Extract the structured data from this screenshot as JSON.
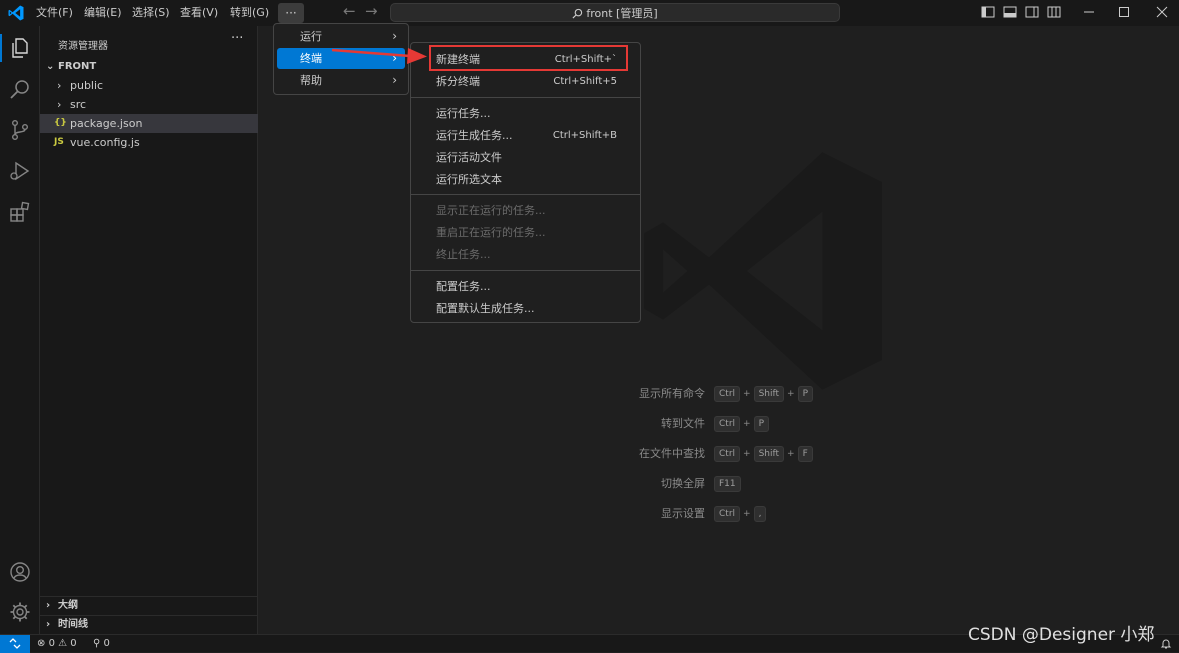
{
  "titlebar": {
    "menus": [
      "文件(F)",
      "编辑(E)",
      "选择(S)",
      "查看(V)",
      "转到(G)"
    ],
    "more": "···",
    "command_center": "front [管理员]"
  },
  "sidebar": {
    "title": "资源管理器",
    "more": "···",
    "folder": "FRONT",
    "items": [
      {
        "label": "public",
        "type": "folder"
      },
      {
        "label": "src",
        "type": "folder"
      },
      {
        "label": "package.json",
        "type": "file",
        "icon": "{}"
      },
      {
        "label": "vue.config.js",
        "type": "file",
        "icon": "JS"
      }
    ],
    "outline": "大纲",
    "timeline": "时间线"
  },
  "menu_top": {
    "items": [
      {
        "label": "运行"
      },
      {
        "label": "终端"
      },
      {
        "label": "帮助"
      }
    ]
  },
  "menu_terminal": {
    "items": [
      {
        "label": "新建终端",
        "shortcut": "Ctrl+Shift+`"
      },
      {
        "label": "拆分终端",
        "shortcut": "Ctrl+Shift+5"
      },
      {
        "label": "运行任务...",
        "shortcut": ""
      },
      {
        "label": "运行生成任务...",
        "shortcut": "Ctrl+Shift+B"
      },
      {
        "label": "运行活动文件",
        "shortcut": ""
      },
      {
        "label": "运行所选文本",
        "shortcut": ""
      },
      {
        "label": "显示正在运行的任务...",
        "shortcut": ""
      },
      {
        "label": "重启正在运行的任务...",
        "shortcut": ""
      },
      {
        "label": "终止任务...",
        "shortcut": ""
      },
      {
        "label": "配置任务...",
        "shortcut": ""
      },
      {
        "label": "配置默认生成任务...",
        "shortcut": ""
      }
    ]
  },
  "hints": [
    {
      "label": "显示所有命令",
      "keys": [
        "Ctrl",
        "Shift",
        "P"
      ]
    },
    {
      "label": "转到文件",
      "keys": [
        "Ctrl",
        "P"
      ]
    },
    {
      "label": "在文件中查找",
      "keys": [
        "Ctrl",
        "Shift",
        "F"
      ]
    },
    {
      "label": "切换全屏",
      "keys": [
        "F11"
      ]
    },
    {
      "label": "显示设置",
      "keys": [
        "Ctrl",
        ","
      ]
    }
  ],
  "statusbar": {
    "errors": "0",
    "warnings": "0",
    "ports": "0"
  },
  "watermark": "CSDN @Designer 小郑",
  "colors": {
    "accent": "#0078d4",
    "highlight": "#e53935",
    "background": "#1f1f1f"
  }
}
